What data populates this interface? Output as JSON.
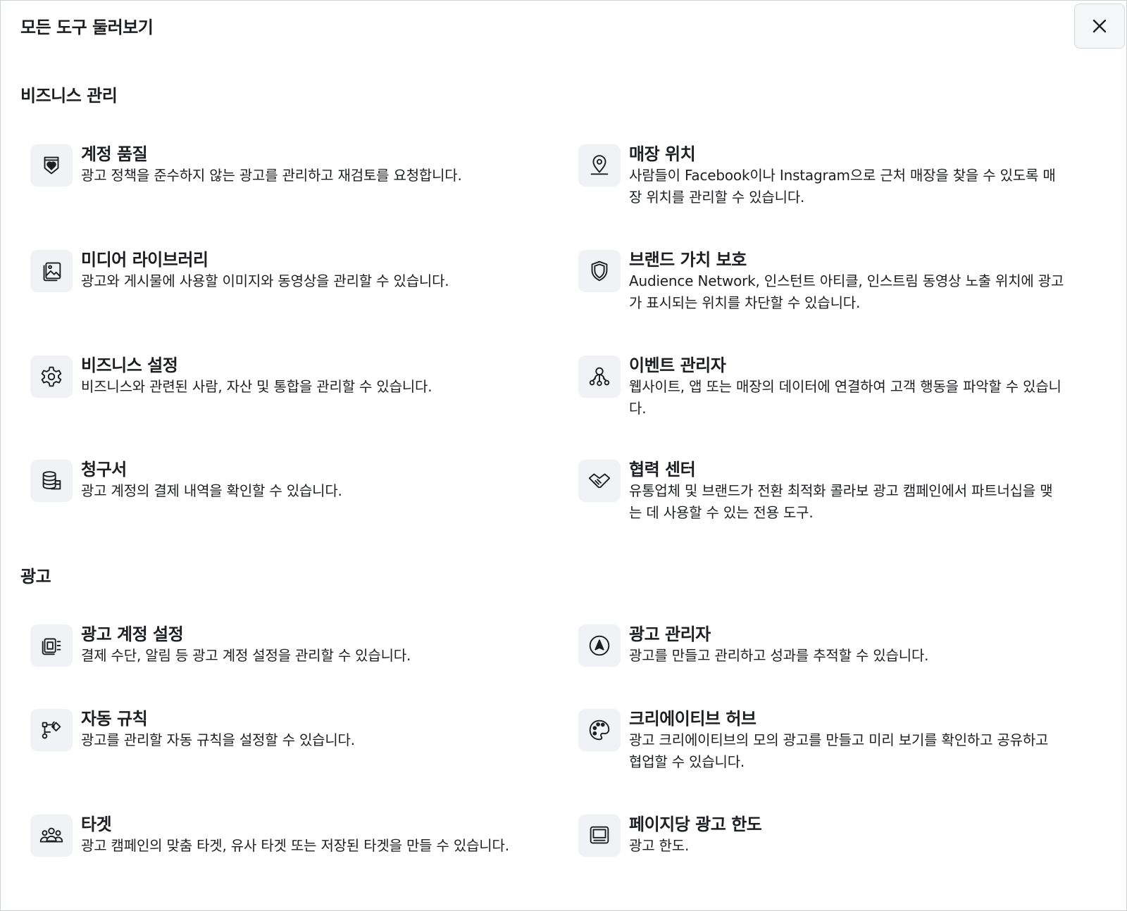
{
  "dialog": {
    "title": "모든 도구 둘러보기",
    "close_icon": "close-icon"
  },
  "sections": [
    {
      "title": "비즈니스 관리",
      "tools": [
        {
          "name": "계정 품질",
          "description": "광고 정책을 준수하지 않는 광고를 관리하고 재검토를 요청합니다.",
          "icon": "shield-heart-icon"
        },
        {
          "name": "매장 위치",
          "description": "사람들이 Facebook이나 Instagram으로 근처 매장을 찾을 수 있도록 매장 위치를 관리할 수 있습니다.",
          "icon": "map-pin-icon"
        },
        {
          "name": "미디어 라이브러리",
          "description": "광고와 게시물에 사용할 이미지와 동영상을 관리할 수 있습니다.",
          "icon": "image-stack-icon"
        },
        {
          "name": "브랜드 가치 보호",
          "description": "Audience Network, 인스턴트 아티클, 인스트림 동영상 노출 위치에 광고가 표시되는 위치를 차단할 수 있습니다.",
          "icon": "shield-icon"
        },
        {
          "name": "비즈니스 설정",
          "description": "비즈니스와 관련된 사람, 자산 및 통합을 관리할 수 있습니다.",
          "icon": "gear-icon"
        },
        {
          "name": "이벤트 관리자",
          "description": "웹사이트, 앱 또는 매장의 데이터에 연결하여 고객 행동을 파악할 수 있습니다.",
          "icon": "people-network-icon"
        },
        {
          "name": "청구서",
          "description": "광고 계정의 결제 내역을 확인할 수 있습니다.",
          "icon": "coin-stack-icon"
        },
        {
          "name": "협력 센터",
          "description": "유통업체 및 브랜드가 전환 최적화 콜라보 광고 캠페인에서 파트너십을 맺는 데 사용할 수 있는 전용 도구.",
          "icon": "handshake-icon"
        }
      ]
    },
    {
      "title": "광고",
      "tools": [
        {
          "name": "광고 계정 설정",
          "description": "결제 수단, 알림 등 광고 계정 설정을 관리할 수 있습니다.",
          "icon": "account-settings-icon"
        },
        {
          "name": "광고 관리자",
          "description": "광고를 만들고 관리하고 성과를 추적할 수 있습니다.",
          "icon": "navigation-arrow-icon"
        },
        {
          "name": "자동 규칙",
          "description": "광고를 관리할 자동 규칙을 설정할 수 있습니다.",
          "icon": "flow-rule-icon"
        },
        {
          "name": "크리에이티브 허브",
          "description": "광고 크리에이티브의 모의 광고를 만들고 미리 보기를 확인하고 공유하고 협업할 수 있습니다.",
          "icon": "palette-icon"
        },
        {
          "name": "타겟",
          "description": "광고 캠페인의 맞춤 타겟, 유사 타겟 또는 저장된 타겟을 만들 수 있습니다.",
          "icon": "audience-icon"
        },
        {
          "name": "페이지당 광고 한도",
          "description": "광고 한도.",
          "icon": "monitor-icon"
        }
      ]
    }
  ]
}
